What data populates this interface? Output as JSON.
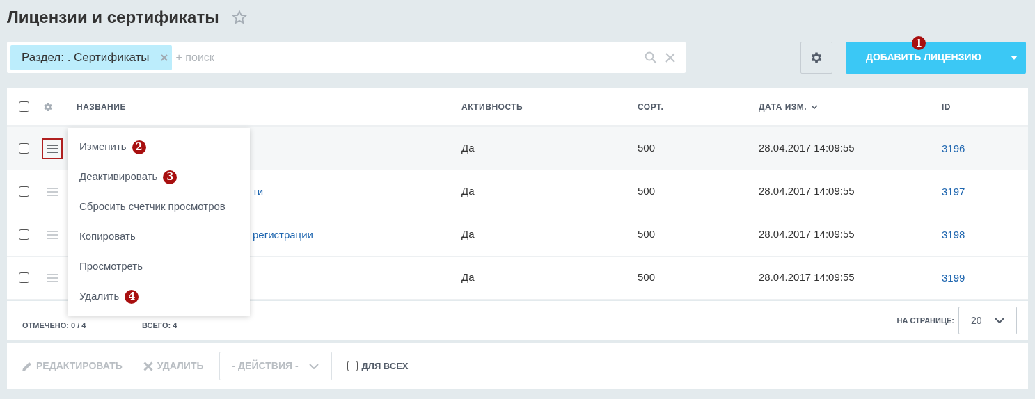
{
  "page": {
    "title": "Лицензии и сертификаты",
    "favorite": false
  },
  "filter": {
    "tag": "Раздел: . Сертификаты",
    "placeholder": "+ поиск"
  },
  "add_button": {
    "label": "ДОБАВИТЬ ЛИЦЕНЗИЮ",
    "badge": "1"
  },
  "table": {
    "all_checked": false,
    "columns": [
      "НАЗВАНИЕ",
      "АКТИВНОСТЬ",
      "СОРТ.",
      "ДАТА ИЗМ.",
      "ID"
    ],
    "rows": [
      {
        "checked": false,
        "selected": true,
        "name": "",
        "active": "Да",
        "sort": "500",
        "date": "28.04.2017 14:09:55",
        "id": "3196"
      },
      {
        "checked": false,
        "selected": false,
        "name": "ти",
        "active": "Да",
        "sort": "500",
        "date": "28.04.2017 14:09:55",
        "id": "3197"
      },
      {
        "checked": false,
        "selected": false,
        "name": "регистрации",
        "active": "Да",
        "sort": "500",
        "date": "28.04.2017 14:09:55",
        "id": "3198"
      },
      {
        "checked": false,
        "selected": false,
        "name": "",
        "active": "Да",
        "sort": "500",
        "date": "28.04.2017 14:09:55",
        "id": "3199"
      }
    ],
    "checked_count": "ОТМЕЧЕНО: 0 / 4",
    "total": "ВСЕГО: 4",
    "per_page_label": "НА СТРАНИЦЕ:",
    "per_page": "20"
  },
  "context_menu": [
    {
      "label": "Изменить",
      "badge": "2"
    },
    {
      "label": "Деактивировать",
      "badge": "3"
    },
    {
      "label": "Сбросить счетчик просмотров"
    },
    {
      "label": "Копировать"
    },
    {
      "label": "Просмотреть"
    },
    {
      "label": "Удалить",
      "badge": "4"
    }
  ],
  "action_bar": {
    "edit": "РЕДАКТИРОВАТЬ",
    "delete": "УДАЛИТЬ",
    "actions": "- ДЕЙСТВИЯ -",
    "for_all": "ДЛЯ ВСЕХ",
    "for_all_checked": false
  }
}
